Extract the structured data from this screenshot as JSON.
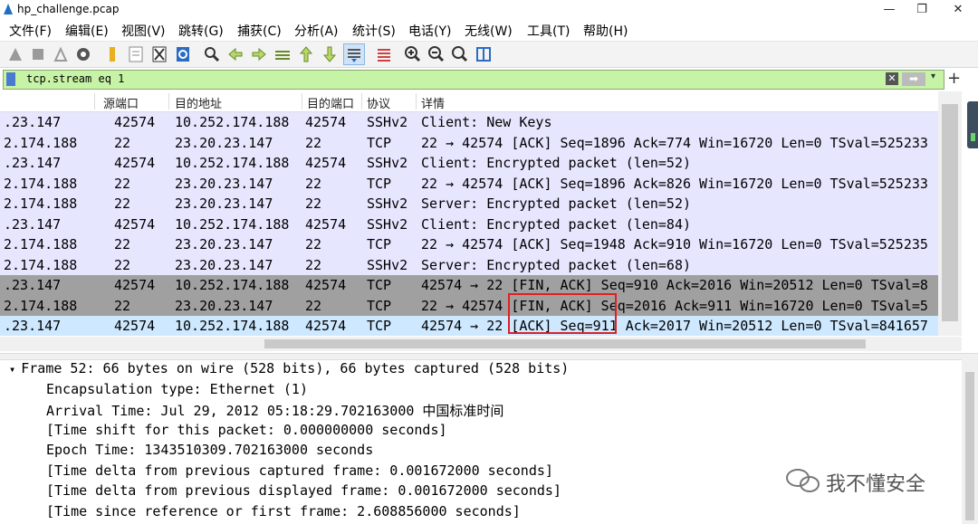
{
  "window": {
    "title": "hp_challenge.pcap",
    "controls": {
      "minimize": "—",
      "restore": "❐",
      "close": "✕"
    }
  },
  "menu": [
    "文件(F)",
    "编辑(E)",
    "视图(V)",
    "跳转(G)",
    "捕获(C)",
    "分析(A)",
    "统计(S)",
    "电话(Y)",
    "无线(W)",
    "工具(T)",
    "帮助(H)"
  ],
  "toolbar": {
    "icons": [
      "shark-start-icon",
      "stop-icon",
      "restart-icon",
      "options-gear-icon",
      "open-folder-icon",
      "save-file-icon",
      "close-file-icon",
      "reload-icon",
      "find-icon",
      "back-arrow-icon",
      "forward-arrow-icon",
      "go-to-packet-icon",
      "first-packet-icon",
      "last-packet-icon",
      "auto-scroll-icon",
      "colorize-icon",
      "zoom-in-icon",
      "zoom-out-icon",
      "zoom-normal-icon",
      "resize-columns-icon"
    ]
  },
  "filter": {
    "value": "tcp.stream eq 1",
    "clear": "✕",
    "apply": "➡",
    "dropdown": "▾",
    "add": "+"
  },
  "columns": {
    "src": "",
    "src_port": "源端口",
    "dst": "目的地址",
    "dst_port": "目的端口",
    "protocol": "协议",
    "info": "详情"
  },
  "packets": [
    {
      "src": ".23.147",
      "src_port": "42574",
      "dst": "10.252.174.188",
      "dst_port": "42574",
      "proto": "SSHv2",
      "info": "Client: New Keys",
      "style": "ssh"
    },
    {
      "src": "2.174.188",
      "src_port": "22",
      "dst": "23.20.23.147",
      "dst_port": "22",
      "proto": "TCP",
      "info": "22 → 42574 [ACK] Seq=1896 Ack=774 Win=16720 Len=0 TSval=525233",
      "style": "ssh"
    },
    {
      "src": ".23.147",
      "src_port": "42574",
      "dst": "10.252.174.188",
      "dst_port": "42574",
      "proto": "SSHv2",
      "info": "Client: Encrypted packet (len=52)",
      "style": "ssh"
    },
    {
      "src": "2.174.188",
      "src_port": "22",
      "dst": "23.20.23.147",
      "dst_port": "22",
      "proto": "TCP",
      "info": "22 → 42574 [ACK] Seq=1896 Ack=826 Win=16720 Len=0 TSval=525233",
      "style": "ssh"
    },
    {
      "src": "2.174.188",
      "src_port": "22",
      "dst": "23.20.23.147",
      "dst_port": "22",
      "proto": "SSHv2",
      "info": "Server: Encrypted packet (len=52)",
      "style": "ssh"
    },
    {
      "src": ".23.147",
      "src_port": "42574",
      "dst": "10.252.174.188",
      "dst_port": "42574",
      "proto": "SSHv2",
      "info": "Client: Encrypted packet (len=84)",
      "style": "ssh"
    },
    {
      "src": "2.174.188",
      "src_port": "22",
      "dst": "23.20.23.147",
      "dst_port": "22",
      "proto": "TCP",
      "info": "22 → 42574 [ACK] Seq=1948 Ack=910 Win=16720 Len=0 TSval=525235",
      "style": "ssh"
    },
    {
      "src": "2.174.188",
      "src_port": "22",
      "dst": "23.20.23.147",
      "dst_port": "22",
      "proto": "SSHv2",
      "info": "Server: Encrypted packet (len=68)",
      "style": "ssh"
    },
    {
      "src": ".23.147",
      "src_port": "42574",
      "dst": "10.252.174.188",
      "dst_port": "42574",
      "proto": "TCP",
      "info": "42574 → 22 [FIN, ACK] Seq=910 Ack=2016 Win=20512 Len=0 TSval=8",
      "style": "fin"
    },
    {
      "src": "2.174.188",
      "src_port": "22",
      "dst": "23.20.23.147",
      "dst_port": "22",
      "proto": "TCP",
      "info": "22 → 42574 [FIN, ACK] Seq=2016 Ack=911 Win=16720 Len=0 TSval=5",
      "style": "fin"
    },
    {
      "src": ".23.147",
      "src_port": "42574",
      "dst": "10.252.174.188",
      "dst_port": "42574",
      "proto": "TCP",
      "info": "42574 → 22 [ACK] Seq=911 Ack=2017 Win=20512 Len=0 TSval=841657",
      "style": "sel"
    }
  ],
  "details": [
    {
      "text": "Frame 52: 66 bytes on wire (528 bits), 66 bytes captured (528 bits)",
      "toggle": "▾",
      "indent": 0
    },
    {
      "text": "Encapsulation type: Ethernet (1)",
      "indent": 1
    },
    {
      "text": "Arrival Time: Jul 29, 2012 05:18:29.702163000 中国标准时间",
      "indent": 1
    },
    {
      "text": "[Time shift for this packet: 0.000000000 seconds]",
      "indent": 1
    },
    {
      "text": "Epoch Time: 1343510309.702163000 seconds",
      "indent": 1
    },
    {
      "text": "[Time delta from previous captured frame: 0.001672000 seconds]",
      "indent": 1
    },
    {
      "text": "[Time delta from previous displayed frame: 0.001672000 seconds]",
      "indent": 1
    },
    {
      "text": "[Time since reference or first frame: 2.608856000 seconds]",
      "indent": 1
    }
  ],
  "watermark": "我不懂安全",
  "colors": {
    "ssh_row": "#e7e6ff",
    "fin_row": "#a0a0a0",
    "selected_row": "#cde8ff",
    "filter_bg": "#c7f3a6",
    "highlight": "#e02020"
  }
}
